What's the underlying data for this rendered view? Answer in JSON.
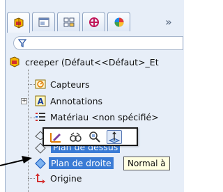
{
  "toolbar": {
    "tabs": [
      {
        "icon": "feature-manager-icon"
      },
      {
        "icon": "property-manager-icon"
      },
      {
        "icon": "configuration-manager-icon"
      },
      {
        "icon": "dimxpert-icon"
      },
      {
        "icon": "display-manager-icon"
      }
    ],
    "more_label": "»"
  },
  "filter": {
    "icon": "filter-icon"
  },
  "tree": {
    "root_label": "creeper  (Défaut<<Défaut>_Et",
    "items": [
      {
        "label": "Capteurs",
        "icon": "sensors-icon"
      },
      {
        "label": "Annotations",
        "icon": "annotations-icon"
      },
      {
        "label": "Matériau <non spécifié>",
        "icon": "material-icon"
      },
      {
        "label": "Plan de dessus",
        "icon": "plane-icon"
      },
      {
        "label": "Plan de droite",
        "icon": "plane-icon"
      },
      {
        "label": "Origine",
        "icon": "origin-icon"
      }
    ]
  },
  "context_toolbar": {
    "buttons": [
      {
        "icon": "edit-sketch-icon"
      },
      {
        "icon": "hide-show-icon"
      },
      {
        "icon": "zoom-to-selection-icon"
      },
      {
        "icon": "normal-to-icon"
      }
    ]
  },
  "tooltip": "Normal à"
}
